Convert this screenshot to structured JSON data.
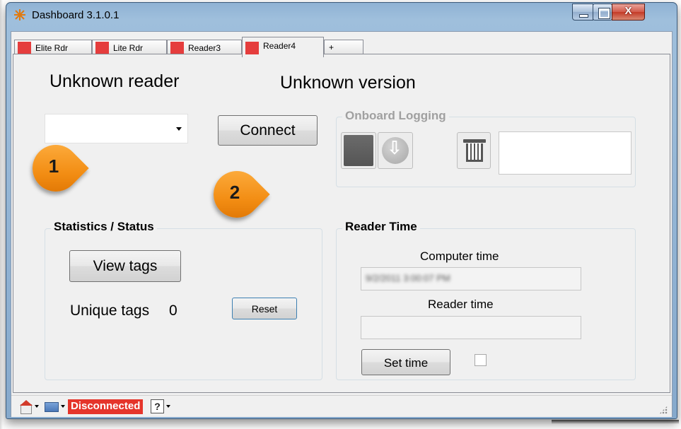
{
  "window": {
    "title": "Dashboard 3.1.0.1",
    "close_glyph": "X"
  },
  "tabs": [
    {
      "label": "Elite Rdr",
      "color": "#e53d3d",
      "active": false
    },
    {
      "label": "Lite Rdr",
      "color": "#e53d3d",
      "active": false
    },
    {
      "label": "Reader3",
      "color": "#e53d3d",
      "active": false
    },
    {
      "label": "Reader4",
      "color": "#e53d3d",
      "active": true
    },
    {
      "label": "+",
      "active": false
    }
  ],
  "header": {
    "reader_name": "Unknown reader",
    "version": "Unknown version"
  },
  "connection": {
    "reader_select_value": "",
    "connect_label": "Connect"
  },
  "callouts": [
    "1",
    "2"
  ],
  "logging": {
    "title": "Onboard Logging",
    "icons": [
      "stop-icon",
      "download-icon",
      "trash-icon"
    ]
  },
  "stats": {
    "title": "Statistics / Status",
    "view_tags_label": "View tags",
    "unique_tags_label": "Unique tags",
    "unique_tags_value": "0",
    "reset_label": "Reset"
  },
  "reader_time": {
    "title": "Reader Time",
    "computer_time_label": "Computer time",
    "computer_time_value": "9/2/2011 3:00:07 PM",
    "reader_time_label": "Reader time",
    "reader_time_value": "",
    "set_time_label": "Set time",
    "sync_checked": false
  },
  "statusbar": {
    "status": "Disconnected",
    "status_color": "#e5352b",
    "help_glyph": "?"
  }
}
